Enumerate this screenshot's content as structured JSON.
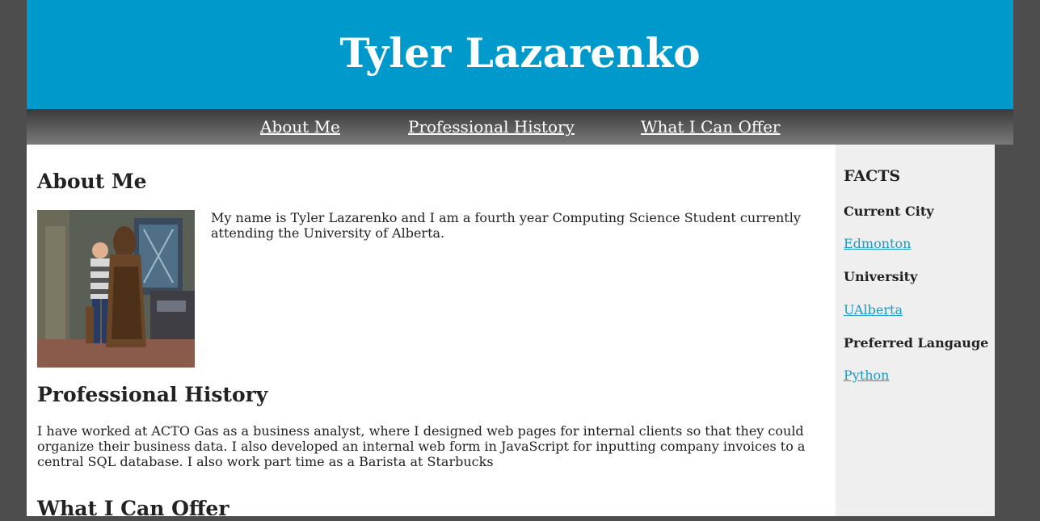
{
  "header": {
    "title": "Tyler Lazarenko"
  },
  "nav": {
    "items": [
      {
        "label": "About Me"
      },
      {
        "label": "Professional History"
      },
      {
        "label": "What I Can Offer"
      }
    ]
  },
  "main": {
    "about": {
      "heading": "About Me",
      "photo_icon": "profile-photo",
      "text": "My name is Tyler Lazarenko and I am a fourth year Computing Science Student currently attending the University of Alberta."
    },
    "professional": {
      "heading": "Professional History",
      "text": "I have worked at ACTO Gas as a business analyst, where I designed web pages for internal clients so that they could organize their business data. I also developed an internal web form in JavaScript for inputting company invoices to a central SQL database. I also work part time as a Barista at Starbucks"
    },
    "offer": {
      "heading": "What I Can Offer"
    }
  },
  "sidebar": {
    "title": "FACTS",
    "facts": [
      {
        "label": "Current City",
        "value": "Edmonton"
      },
      {
        "label": "University",
        "value": "UAlberta"
      },
      {
        "label": "Preferred Langauge",
        "value": "Python"
      }
    ]
  },
  "colors": {
    "background": "#4d4d4d",
    "banner": "#0099cc",
    "link": "#1a9bc6",
    "sidebar": "#efefef"
  }
}
